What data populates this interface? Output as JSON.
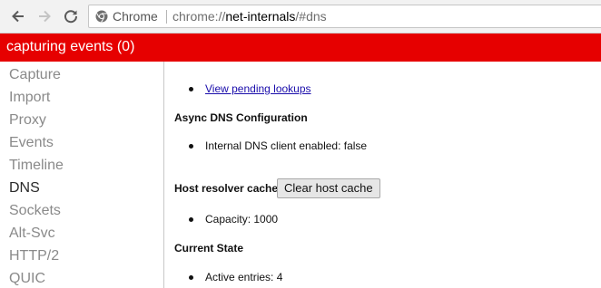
{
  "browser": {
    "back_icon": "back-arrow-icon",
    "forward_icon": "forward-arrow-icon",
    "reload_icon": "reload-icon",
    "site_label": "Chrome",
    "url": {
      "scheme": "chrome://",
      "host": "net-internals",
      "path": "/#dns"
    }
  },
  "status": {
    "text": "capturing events (0)",
    "color": "#e60000"
  },
  "sidebar": {
    "items": [
      {
        "label": "Capture"
      },
      {
        "label": "Import"
      },
      {
        "label": "Proxy"
      },
      {
        "label": "Events"
      },
      {
        "label": "Timeline"
      },
      {
        "label": "DNS",
        "active": true
      },
      {
        "label": "Sockets"
      },
      {
        "label": "Alt-Svc"
      },
      {
        "label": "HTTP/2"
      },
      {
        "label": "QUIC"
      }
    ]
  },
  "main": {
    "pending_link": "View pending lookups",
    "async_heading": "Async DNS Configuration",
    "internal_dns": "Internal DNS client enabled: false",
    "host_cache_label": "Host resolver cache",
    "clear_button": "Clear host cache",
    "capacity": "Capacity: 1000",
    "current_state_heading": "Current State",
    "active_entries": "Active entries: 4"
  }
}
